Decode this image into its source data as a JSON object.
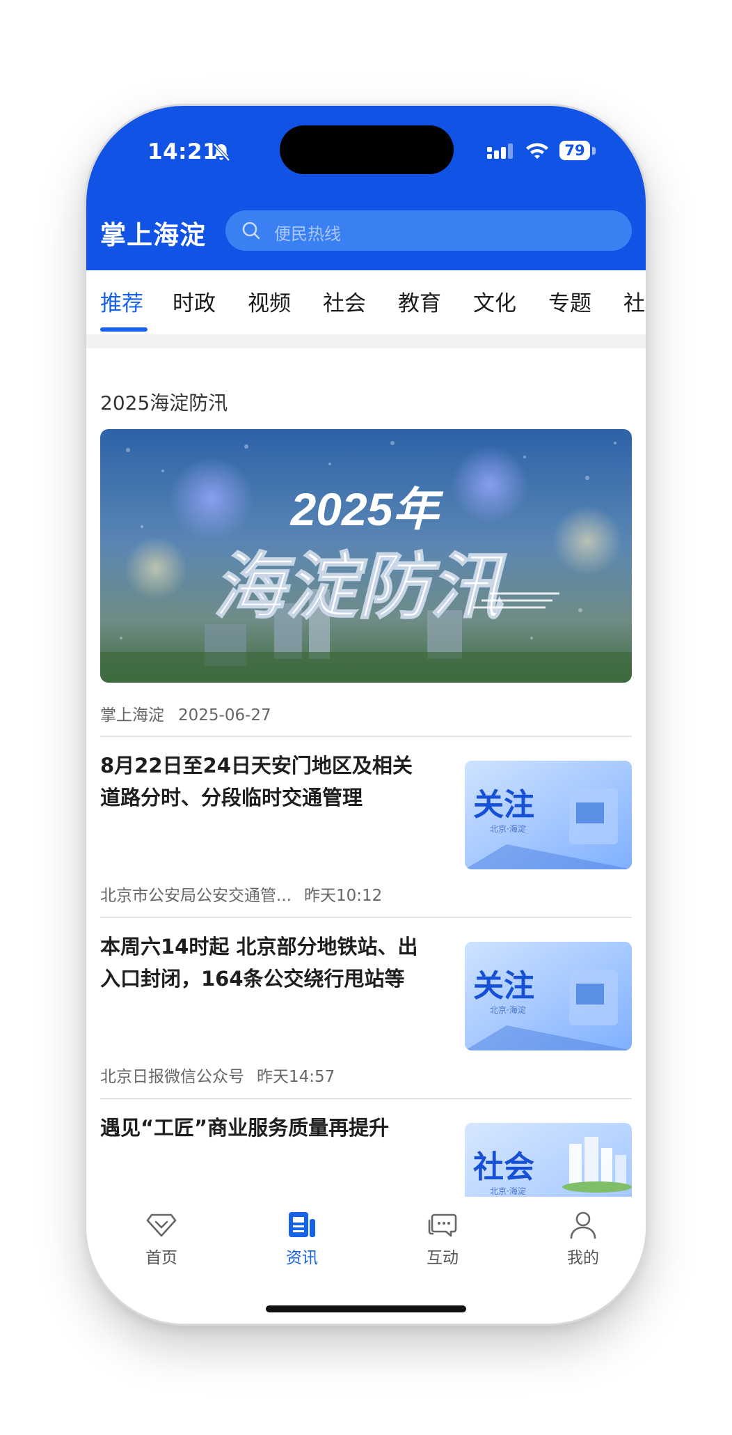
{
  "status_bar": {
    "time": "14:21",
    "battery": "79"
  },
  "header": {
    "app_title": "掌上海淀",
    "search_placeholder": "便民热线"
  },
  "tabs": [
    "推荐",
    "时政",
    "视频",
    "社会",
    "教育",
    "文化",
    "专题",
    "社"
  ],
  "active_tab": "推荐",
  "feed": {
    "topic": {
      "title": "2025海淀防汛",
      "image_text_line1": "2025年",
      "image_text_line2": "海淀防汛",
      "source": "掌上海淀",
      "date": "2025-06-27"
    },
    "items": [
      {
        "title": "8月22日至24日天安门地区及相关道路分时、分段临时交通管理",
        "source": "北京市公安局公安交通管...",
        "time": "昨天10:12",
        "thumb_label": "关注",
        "thumb_sub": "北京·海淀"
      },
      {
        "title": "本周六14时起 北京部分地铁站、出入口封闭，164条公交绕行甩站等",
        "source": "北京日报微信公众号",
        "time": "昨天14:57",
        "thumb_label": "关注",
        "thumb_sub": "北京·海淀"
      },
      {
        "title": "遇见“工匠”商业服务质量再提升",
        "thumb_label": "社会",
        "thumb_sub": "北京·海淀"
      }
    ]
  },
  "bottom_nav": [
    {
      "label": "首页",
      "icon": "home-diamond-icon"
    },
    {
      "label": "资讯",
      "icon": "news-icon"
    },
    {
      "label": "互动",
      "icon": "chat-bubbles-icon"
    },
    {
      "label": "我的",
      "icon": "profile-icon"
    }
  ],
  "bottom_nav_active": "资讯",
  "colors": {
    "brand_blue": "#1153e5",
    "search_bg": "#3b80f2",
    "active_tab": "#1662e8",
    "page_bg": "#ffffff"
  }
}
